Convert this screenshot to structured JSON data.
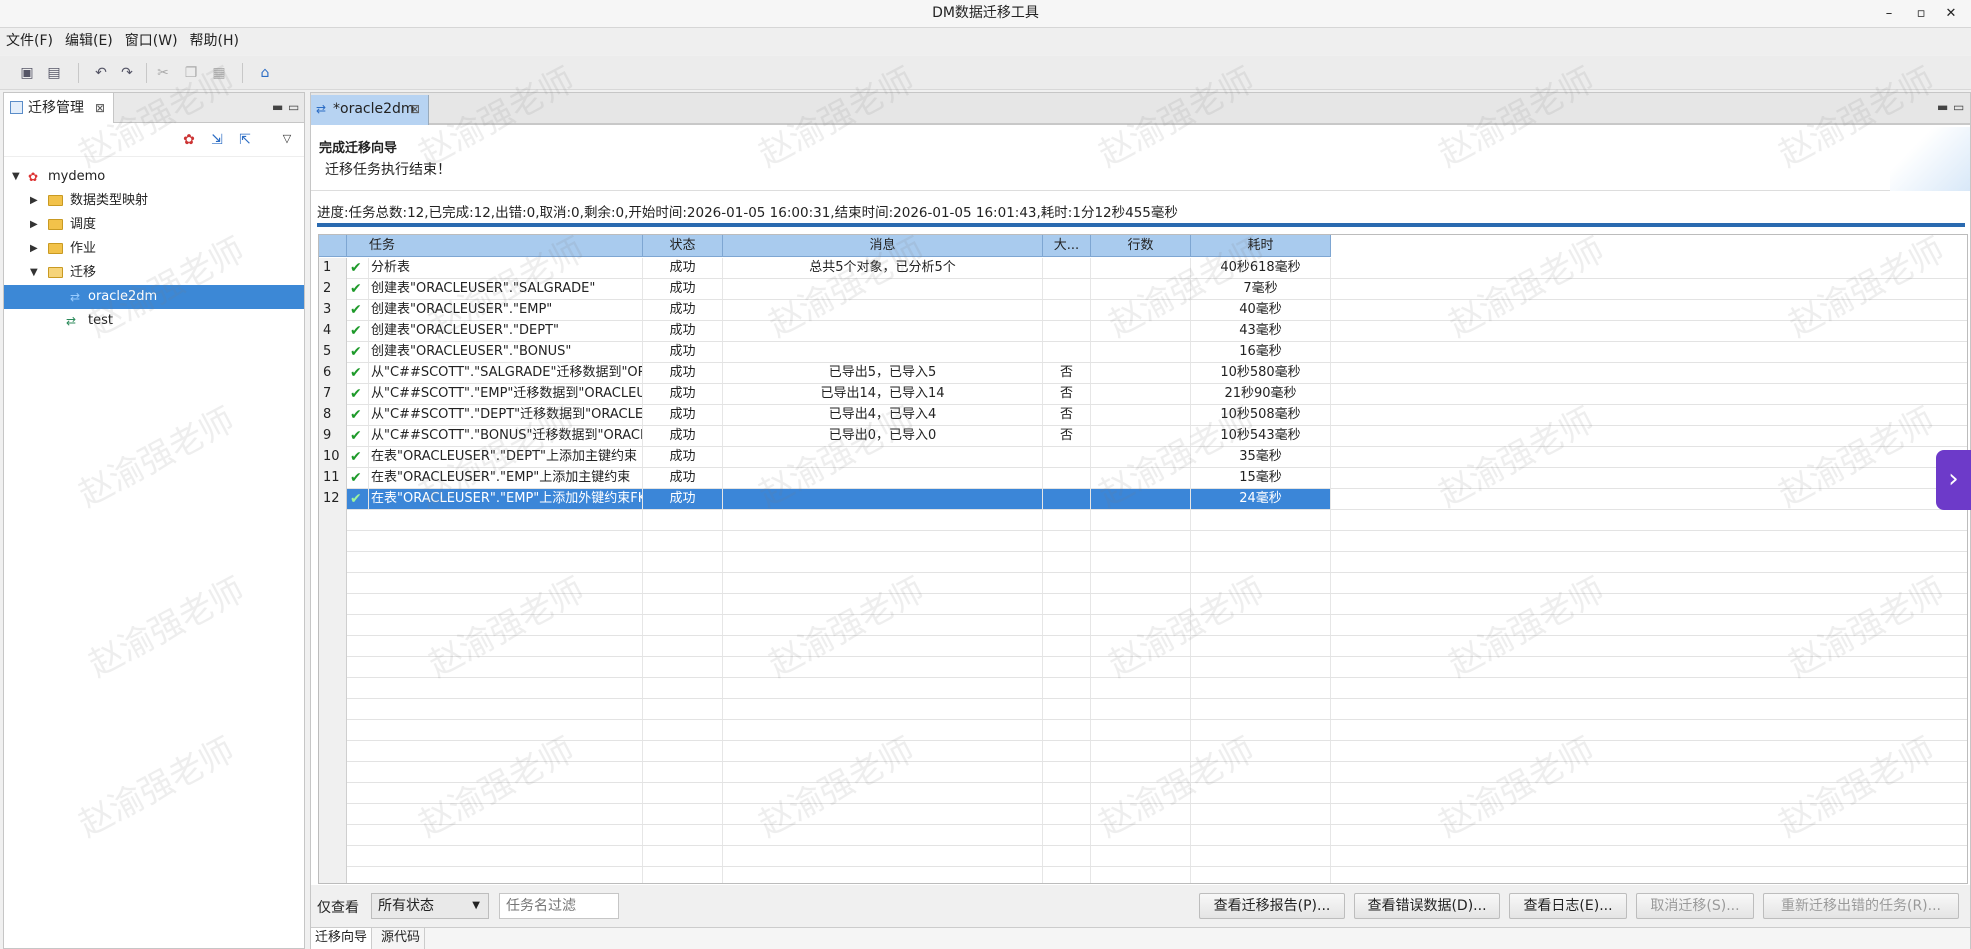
{
  "window": {
    "title": "DM数据迁移工具"
  },
  "menu": [
    "文件(F)",
    "编辑(E)",
    "窗口(W)",
    "帮助(H)"
  ],
  "left_panel": {
    "tab_label": "迁移管理",
    "tree": [
      {
        "label": "mydemo",
        "level": 0,
        "icon": "database-icon",
        "expanded": true
      },
      {
        "label": "数据类型映射",
        "level": 1,
        "icon": "folder-icon",
        "expanded": false
      },
      {
        "label": "调度",
        "level": 1,
        "icon": "folder-icon",
        "expanded": false
      },
      {
        "label": "作业",
        "level": 1,
        "icon": "folder-icon",
        "expanded": false
      },
      {
        "label": "迁移",
        "level": 1,
        "icon": "folder-icon",
        "expanded": true
      },
      {
        "label": "oracle2dm",
        "level": 2,
        "icon": "migration-icon",
        "selected": true
      },
      {
        "label": "test",
        "level": 2,
        "icon": "migration-icon"
      }
    ]
  },
  "editor": {
    "tab_label": "*oracle2dm",
    "wizard_title": "完成迁移向导",
    "wizard_desc": "迁移任务执行结束！",
    "progress_text": "进度:任务总数:12,已完成:12,出错:0,取消:0,剩余:0,开始时间:2026-01-05 16:00:31,结束时间:2026-01-05 16:01:43,耗时:1分12秒455毫秒",
    "progress": 1.0,
    "table": {
      "columns": [
        "任务",
        "状态",
        "消息",
        "大...",
        "行数",
        "耗时"
      ],
      "rows": [
        {
          "n": "1",
          "task": "分析表",
          "status": "成功",
          "msg": "总共5个对象，已分析5个",
          "big": "",
          "rows": "",
          "time": "40秒618毫秒"
        },
        {
          "n": "2",
          "task": "创建表\"ORACLEUSER\".\"SALGRADE\"",
          "status": "成功",
          "msg": "",
          "big": "",
          "rows": "",
          "time": "7毫秒"
        },
        {
          "n": "3",
          "task": "创建表\"ORACLEUSER\".\"EMP\"",
          "status": "成功",
          "msg": "",
          "big": "",
          "rows": "",
          "time": "40毫秒"
        },
        {
          "n": "4",
          "task": "创建表\"ORACLEUSER\".\"DEPT\"",
          "status": "成功",
          "msg": "",
          "big": "",
          "rows": "",
          "time": "43毫秒"
        },
        {
          "n": "5",
          "task": "创建表\"ORACLEUSER\".\"BONUS\"",
          "status": "成功",
          "msg": "",
          "big": "",
          "rows": "",
          "time": "16毫秒"
        },
        {
          "n": "6",
          "task": "从\"C##SCOTT\".\"SALGRADE\"迁移数据到\"ORACLE...",
          "status": "成功",
          "msg": "已导出5，已导入5",
          "big": "否",
          "rows": "",
          "time": "10秒580毫秒"
        },
        {
          "n": "7",
          "task": "从\"C##SCOTT\".\"EMP\"迁移数据到\"ORACLEUSER\"...",
          "status": "成功",
          "msg": "已导出14，已导入14",
          "big": "否",
          "rows": "",
          "time": "21秒90毫秒"
        },
        {
          "n": "8",
          "task": "从\"C##SCOTT\".\"DEPT\"迁移数据到\"ORACLEUSER...",
          "status": "成功",
          "msg": "已导出4，已导入4",
          "big": "否",
          "rows": "",
          "time": "10秒508毫秒"
        },
        {
          "n": "9",
          "task": "从\"C##SCOTT\".\"BONUS\"迁移数据到\"ORACLEUS...",
          "status": "成功",
          "msg": "已导出0，已导入0",
          "big": "否",
          "rows": "",
          "time": "10秒543毫秒"
        },
        {
          "n": "10",
          "task": "在表\"ORACLEUSER\".\"DEPT\"上添加主键约束",
          "status": "成功",
          "msg": "",
          "big": "",
          "rows": "",
          "time": "35毫秒"
        },
        {
          "n": "11",
          "task": "在表\"ORACLEUSER\".\"EMP\"上添加主键约束",
          "status": "成功",
          "msg": "",
          "big": "",
          "rows": "",
          "time": "15毫秒"
        },
        {
          "n": "12",
          "task": "在表\"ORACLEUSER\".\"EMP\"上添加外键约束FK_DE...",
          "status": "成功",
          "msg": "",
          "big": "",
          "rows": "",
          "time": "24毫秒",
          "selected": true
        }
      ]
    },
    "filter": {
      "label": "仅查看",
      "status_value": "所有状态",
      "name_placeholder": "任务名过滤"
    },
    "buttons": [
      {
        "label": "查看迁移报告(P)...",
        "enabled": true
      },
      {
        "label": "查看错误数据(D)...",
        "enabled": true
      },
      {
        "label": "查看日志(E)...",
        "enabled": true
      },
      {
        "label": "取消迁移(S)...",
        "enabled": false
      },
      {
        "label": "重新迁移出错的任务(R)...",
        "enabled": false
      }
    ],
    "bottom_tabs": [
      "迁移向导",
      "源代码"
    ]
  },
  "watermark": "赵渝强老师",
  "colors": {
    "selection": "#3b86d8",
    "header": "#a9cbee",
    "success_check": "#1e9a2a",
    "side_button": "#6d3ac9"
  }
}
